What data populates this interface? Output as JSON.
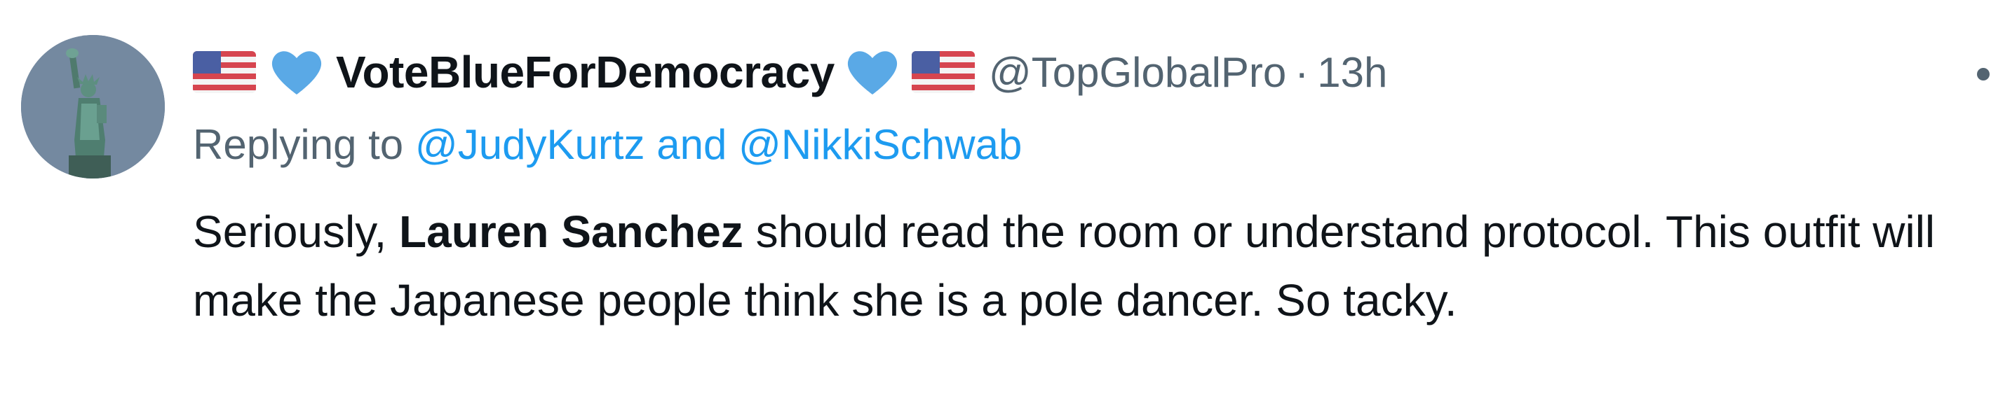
{
  "author": {
    "display_name": "VoteBlueForDemocracy",
    "handle": "@TopGlobalPro",
    "separator": "·",
    "time": "13h",
    "name_decorations": [
      "us-flag-icon",
      "blue-heart-icon"
    ]
  },
  "reply_context": {
    "prefix": "Replying to",
    "mention_1": "@JudyKurtz",
    "conjunction": "and",
    "mention_2": "@NikkiSchwab"
  },
  "body": {
    "part_1": "Seriously,",
    "bold_name": "Lauren Sanchez",
    "part_2": "should read the room or understand protocol. This outfit will make the Japanese people think she is a pole dancer. So tacky."
  },
  "colors": {
    "text": "#0f1419",
    "secondary": "#536471",
    "link": "#1d9bf0",
    "heart": "#5aa9e6"
  }
}
